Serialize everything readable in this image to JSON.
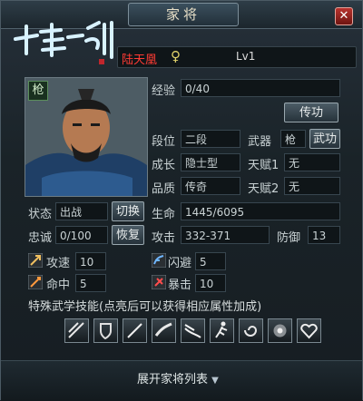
{
  "window": {
    "title": "家将"
  },
  "general": {
    "name": "陆天凰",
    "gender_symbol": "♀",
    "level": "Lv1",
    "type_badge": "枪"
  },
  "stats": {
    "exp_label": "经验",
    "exp_value": "0/40",
    "transfer_button": "传功",
    "rank_label": "段位",
    "rank_value": "二段",
    "weapon_label": "武器",
    "weapon_value": "枪",
    "martial_button": "武功",
    "growth_label": "成长",
    "growth_value": "隐士型",
    "talent1_label": "天赋1",
    "talent1_value": "无",
    "quality_label": "品质",
    "quality_value": "传奇",
    "talent2_label": "天赋2",
    "talent2_value": "无",
    "status_label": "状态",
    "status_value": "出战",
    "switch_button": "切换",
    "hp_label": "生命",
    "hp_value": "1445/6095",
    "loyalty_label": "忠诚",
    "loyalty_value": "0/100",
    "recover_button": "恢复",
    "attack_label": "攻击",
    "attack_value": "332-371",
    "defense_label": "防御",
    "defense_value": "13",
    "speed_label": "攻速",
    "speed_value": "10",
    "dodge_label": "闪避",
    "dodge_value": "5",
    "hit_label": "命中",
    "hit_value": "5",
    "crit_label": "暴击",
    "crit_value": "10"
  },
  "skills": {
    "header": "特殊武学技能(点亮后可以获得相应属性加成)",
    "count": 9
  },
  "footer": {
    "expand_label": "展开家将列表"
  }
}
